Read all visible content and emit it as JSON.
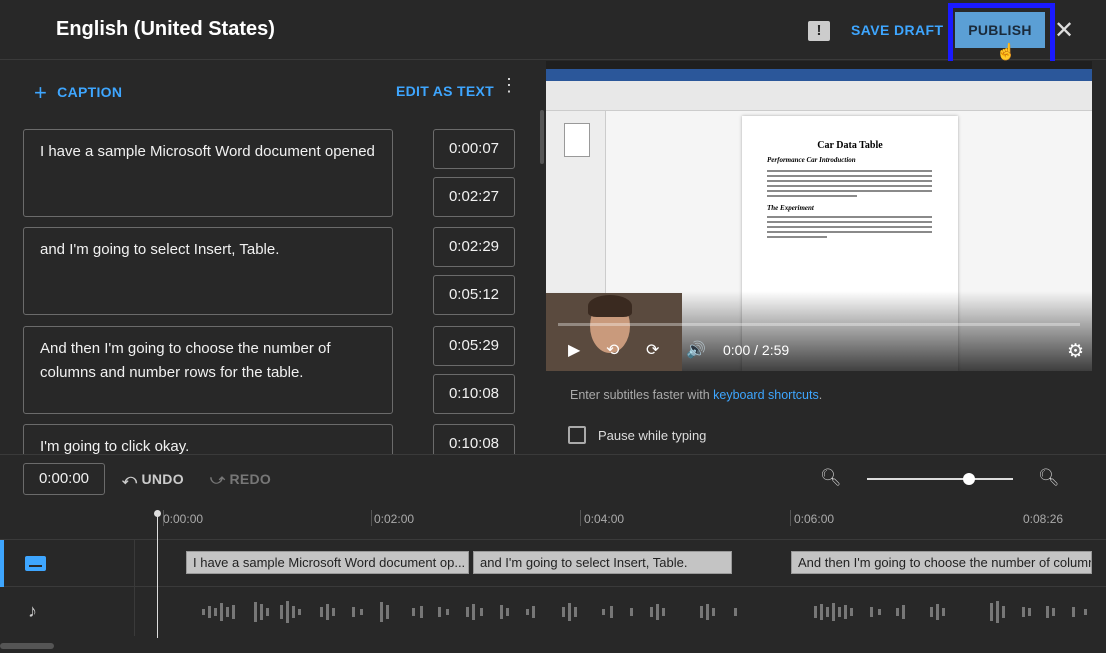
{
  "header": {
    "title": "English (United States)",
    "save_draft": "SAVE DRAFT",
    "publish": "PUBLISH",
    "close_glyph": "✕",
    "feedback_icon": "feedback-icon"
  },
  "editor": {
    "add_caption": "CAPTION",
    "edit_as_text": "EDIT AS TEXT",
    "cues": [
      {
        "text": "I have a sample Microsoft Word document opened",
        "start": "0:00:07",
        "end": "0:02:27"
      },
      {
        "text": "and I'm going to select Insert, Table.",
        "start": "0:02:29",
        "end": "0:05:12"
      },
      {
        "text": "And then I'm going to choose the number of columns and number rows for the table.",
        "start": "0:05:29",
        "end": "0:10:08"
      },
      {
        "text": "I'm going to click okay.",
        "start": "0:10:08",
        "end": ""
      }
    ]
  },
  "video": {
    "doc_title": "Car Data Table",
    "doc_heading1": "Performance Car Introduction",
    "doc_heading2": "The Experiment",
    "time": "0:00 / 2:59"
  },
  "hints": {
    "prefix": "Enter subtitles faster with ",
    "link": "keyboard shortcuts",
    "suffix": ".",
    "pause_label": "Pause while typing"
  },
  "timeline": {
    "current": "0:00:00",
    "undo": "UNDO",
    "redo": "REDO",
    "zoom_level": 0.7,
    "ticks": [
      "0:00:00",
      "0:02:00",
      "0:04:00",
      "0:06:00",
      "0:08:26"
    ],
    "segments": [
      "I have a sample Microsoft Word document op...",
      "and I'm going to select Insert, Table.",
      "And then I'm going to choose the number of columns"
    ]
  },
  "colors": {
    "accent": "#3ea6ff",
    "publish_bg": "#5b9fd5",
    "highlight": "#1a1aff"
  }
}
